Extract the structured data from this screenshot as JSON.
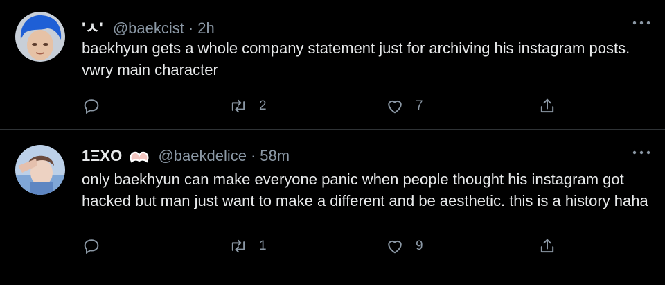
{
  "tweets": [
    {
      "display_name": "'ㅅ'",
      "handle": "@baekcist",
      "separator": "·",
      "time": "2h",
      "text": "baekhyun gets a whole company statement just for archiving his instagram posts. vwry main character",
      "retweets": "2",
      "likes": "7"
    },
    {
      "display_name": "1ΞXO",
      "handle": "@baekdelice",
      "separator": "·",
      "time": "58m",
      "text": "only baekhyun can make everyone panic when people thought his instagram got hacked but man just want to make a different and be aesthetic. this is a history haha",
      "retweets": "1",
      "likes": "9"
    }
  ],
  "icons": {
    "reply": "reply-icon",
    "retweet": "retweet-icon",
    "like": "heart-icon",
    "share": "share-icon",
    "more": "more-options-icon",
    "badge": "heart-hands-emoji-icon"
  },
  "colors": {
    "background": "#000000",
    "text": "#e7e9ea",
    "muted": "#8b98a5",
    "divider": "#2f3336",
    "avatar1_hair": "#1e5fd6"
  }
}
